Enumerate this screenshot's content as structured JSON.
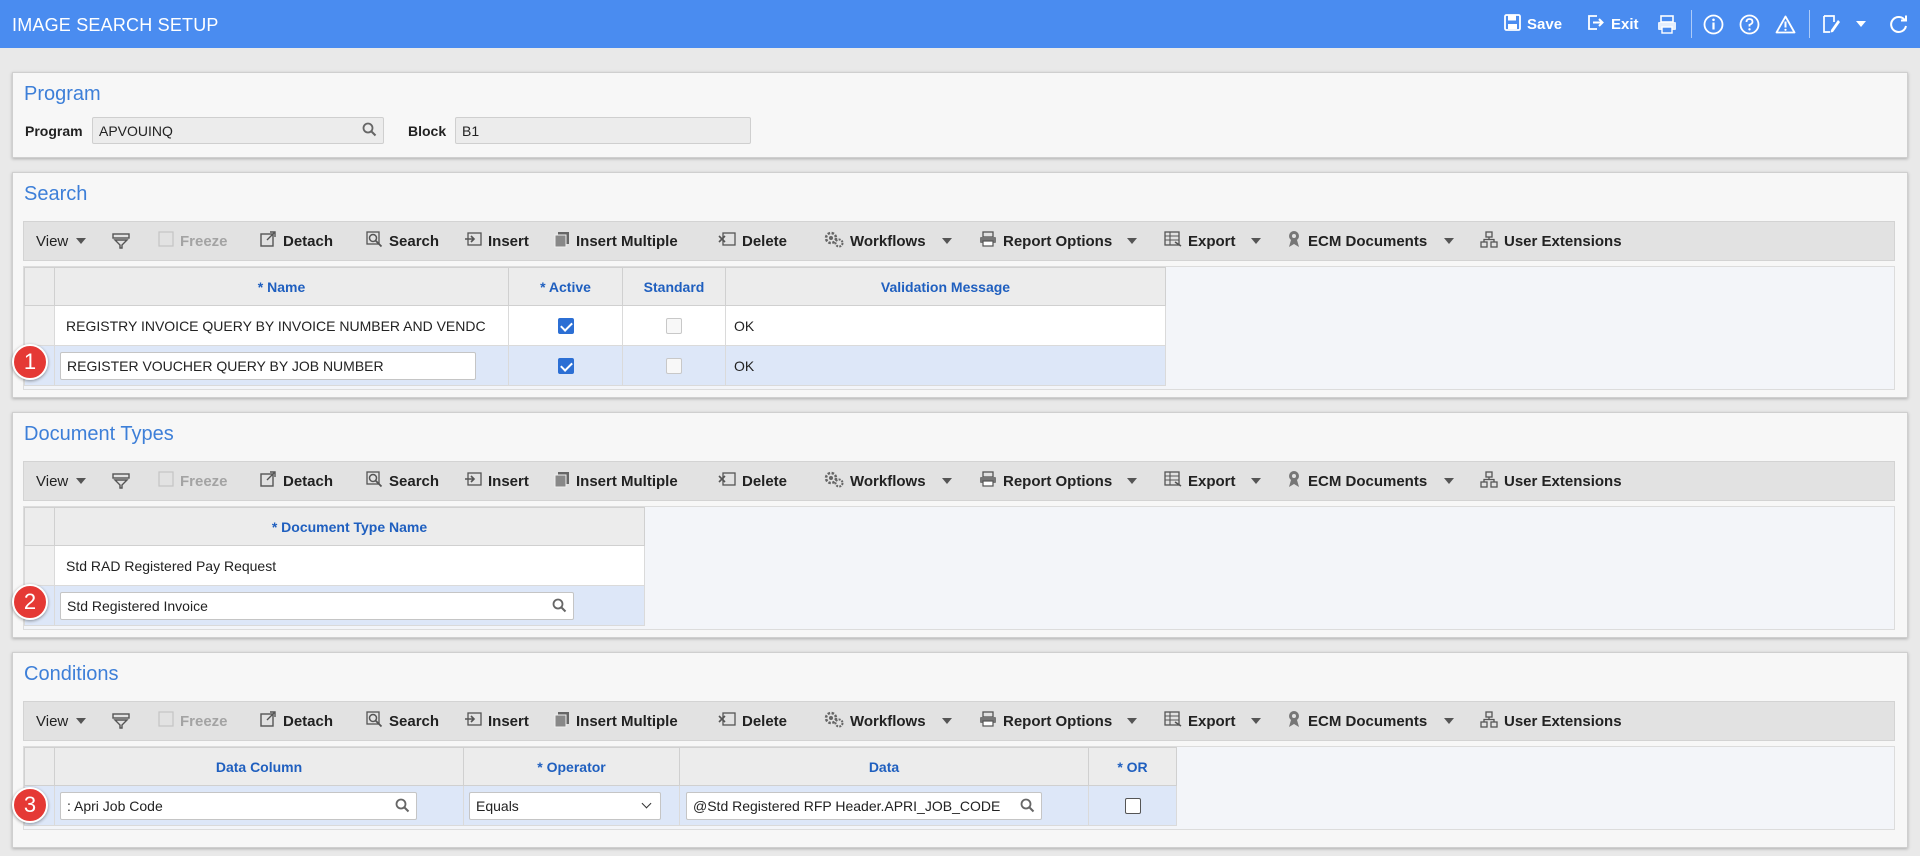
{
  "header": {
    "title": "IMAGE SEARCH SETUP",
    "save_label": "Save",
    "exit_label": "Exit"
  },
  "program_panel": {
    "title": "Program",
    "program_label": "Program",
    "program_value": "APVOUINQ",
    "block_label": "Block",
    "block_value": "B1"
  },
  "toolbar": {
    "view": "View",
    "freeze": "Freeze",
    "detach": "Detach",
    "search": "Search",
    "insert": "Insert",
    "insert_multiple": "Insert Multiple",
    "delete": "Delete",
    "workflows": "Workflows",
    "report_options": "Report Options",
    "export": "Export",
    "ecm_documents": "ECM Documents",
    "user_extensions": "User Extensions"
  },
  "search_panel": {
    "title": "Search",
    "columns": [
      "* Name",
      "* Active",
      "Standard",
      "Validation Message"
    ],
    "rows": [
      {
        "name": "REGISTRY INVOICE QUERY BY INVOICE NUMBER AND VENDC",
        "active": true,
        "standard": false,
        "message": "OK"
      },
      {
        "name": "REGISTER VOUCHER QUERY BY JOB NUMBER",
        "active": true,
        "standard": false,
        "message": "OK"
      }
    ]
  },
  "doctypes_panel": {
    "title": "Document Types",
    "columns": [
      "* Document Type Name"
    ],
    "rows": [
      {
        "name": "Std RAD Registered Pay Request"
      },
      {
        "name": "Std Registered Invoice"
      }
    ]
  },
  "conditions_panel": {
    "title": "Conditions",
    "columns": [
      "Data Column",
      "* Operator",
      "Data",
      "* OR"
    ],
    "rows": [
      {
        "data_column": ": Apri Job Code",
        "operator": "Equals",
        "data": "@Std Registered RFP Header.APRI_JOB_CODE",
        "or": false
      }
    ]
  },
  "markers": [
    "1",
    "2",
    "3"
  ],
  "colors": {
    "header_bg": "#4a8cf0",
    "panel_title": "#3d7fd8",
    "column_header": "#1f5fbf",
    "selected_row": "#dde7f8",
    "marker": "#e53935",
    "checkbox_on": "#2c6fd4"
  }
}
